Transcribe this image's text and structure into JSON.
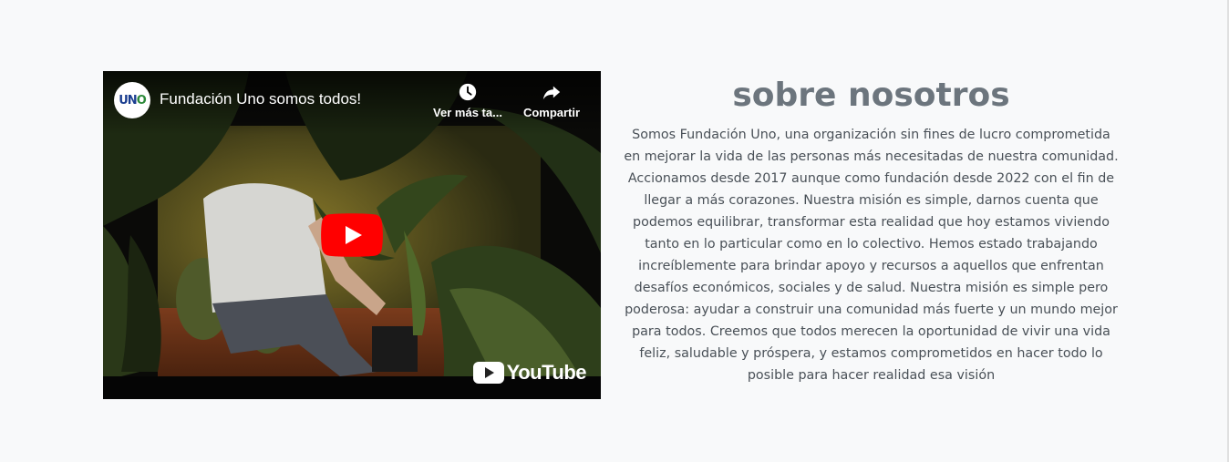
{
  "video": {
    "title": "Fundación Uno somos todos!",
    "channel_logo_text": "UNO",
    "watch_later_label": "Ver más ta...",
    "share_label": "Compartir",
    "provider": "YouTube",
    "play_icon": "play-icon",
    "watch_later_icon": "clock-icon",
    "share_icon": "share-arrow-icon",
    "play_color": "#ff0000"
  },
  "about": {
    "title": "sobre nosotros",
    "body": "Somos Fundación Uno, una organización sin fines de lucro comprometida en mejorar la vida de las personas más necesitadas de nuestra comunidad. Accionamos desde 2017 aunque como fundación desde 2022 con el fin de llegar a más corazones. Nuestra misión es simple, darnos cuenta que podemos equilibrar, transformar esta realidad que hoy estamos viviendo tanto en lo particular como en lo colectivo. Hemos estado trabajando increíblemente para brindar apoyo y recursos a aquellos que enfrentan desafíos económicos, sociales y de salud. Nuestra misión es simple pero poderosa: ayudar a construir una comunidad más fuerte y un mundo mejor para todos. Creemos que todos merecen la oportunidad de vivir una vida feliz, saludable y próspera, y estamos comprometidos en hacer todo lo posible para hacer realidad esa visión",
    "title_color": "#6c757d",
    "text_color": "#495057"
  }
}
